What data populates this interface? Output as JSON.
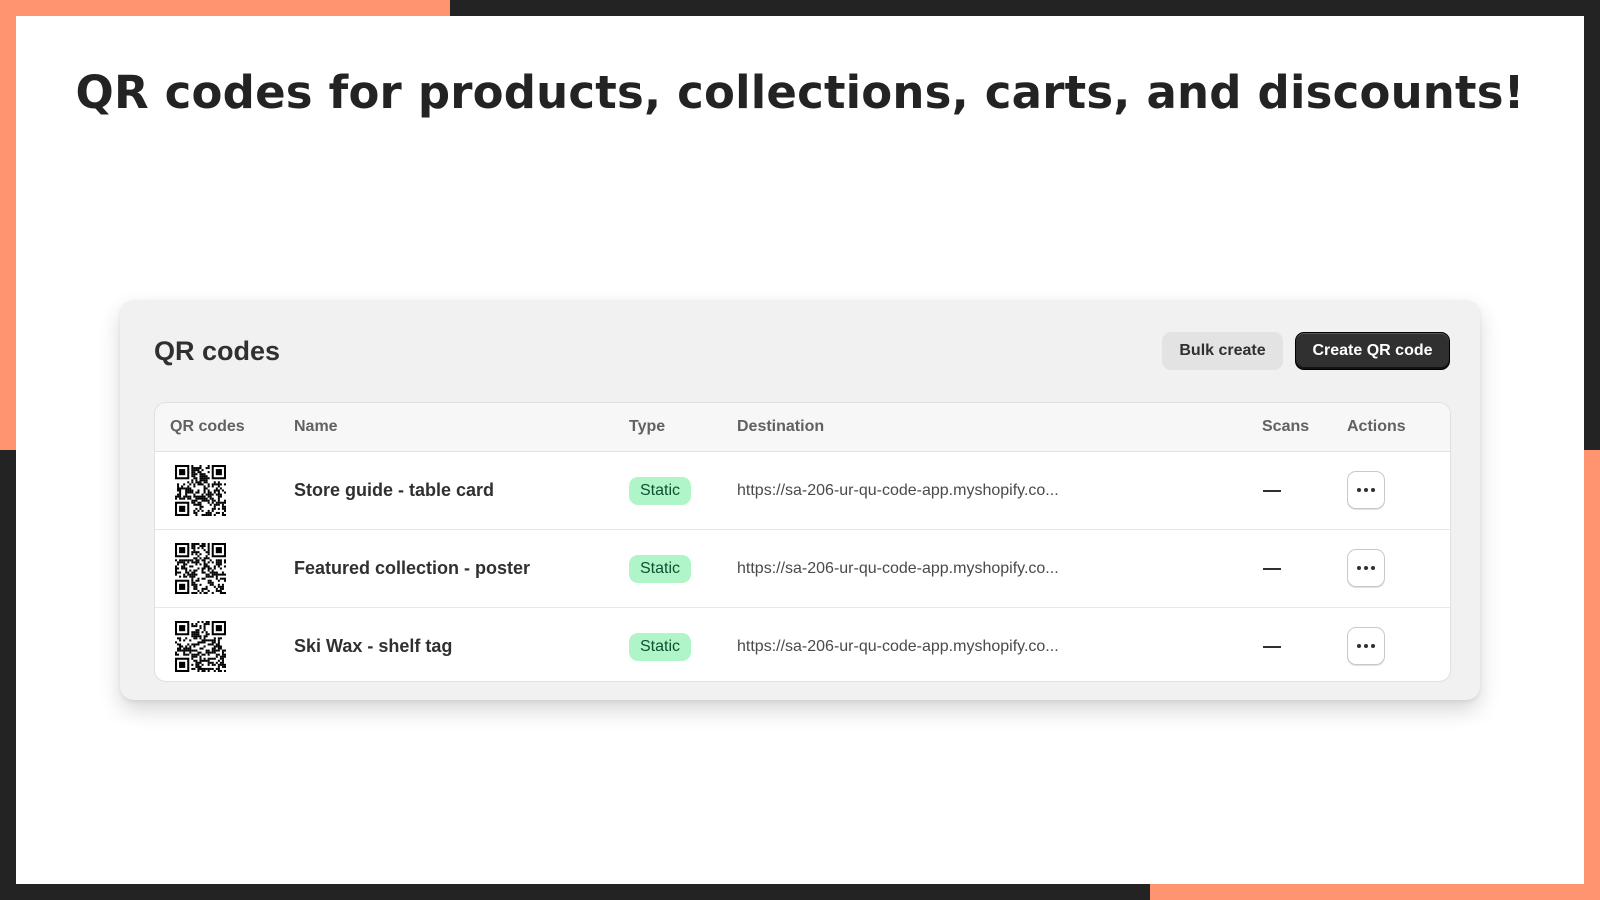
{
  "headline": "QR codes for products, collections, carts, and discounts!",
  "colors": {
    "accent": "#ff9470",
    "frame": "#232323",
    "badge_bg": "#aff5c7",
    "badge_text": "#0c5132"
  },
  "card": {
    "title": "QR codes",
    "bulk_create_label": "Bulk create",
    "create_label": "Create QR code"
  },
  "table": {
    "headers": [
      "QR codes",
      "Name",
      "Type",
      "Destination",
      "Scans",
      "Actions"
    ],
    "rows": [
      {
        "qr_icon": "qr-code-icon",
        "name": "Store guide - table card",
        "type": "Static",
        "destination": "https://sa-206-ur-qu-code-app.myshopify.co...",
        "scans": "—",
        "actions_icon": "more-horizontal-icon"
      },
      {
        "qr_icon": "qr-code-icon",
        "name": "Featured collection - poster",
        "type": "Static",
        "destination": "https://sa-206-ur-qu-code-app.myshopify.co...",
        "scans": "—",
        "actions_icon": "more-horizontal-icon"
      },
      {
        "qr_icon": "qr-code-icon",
        "name": "Ski Wax - shelf tag",
        "type": "Static",
        "destination": "https://sa-206-ur-qu-code-app.myshopify.co...",
        "scans": "—",
        "actions_icon": "more-horizontal-icon"
      }
    ]
  }
}
